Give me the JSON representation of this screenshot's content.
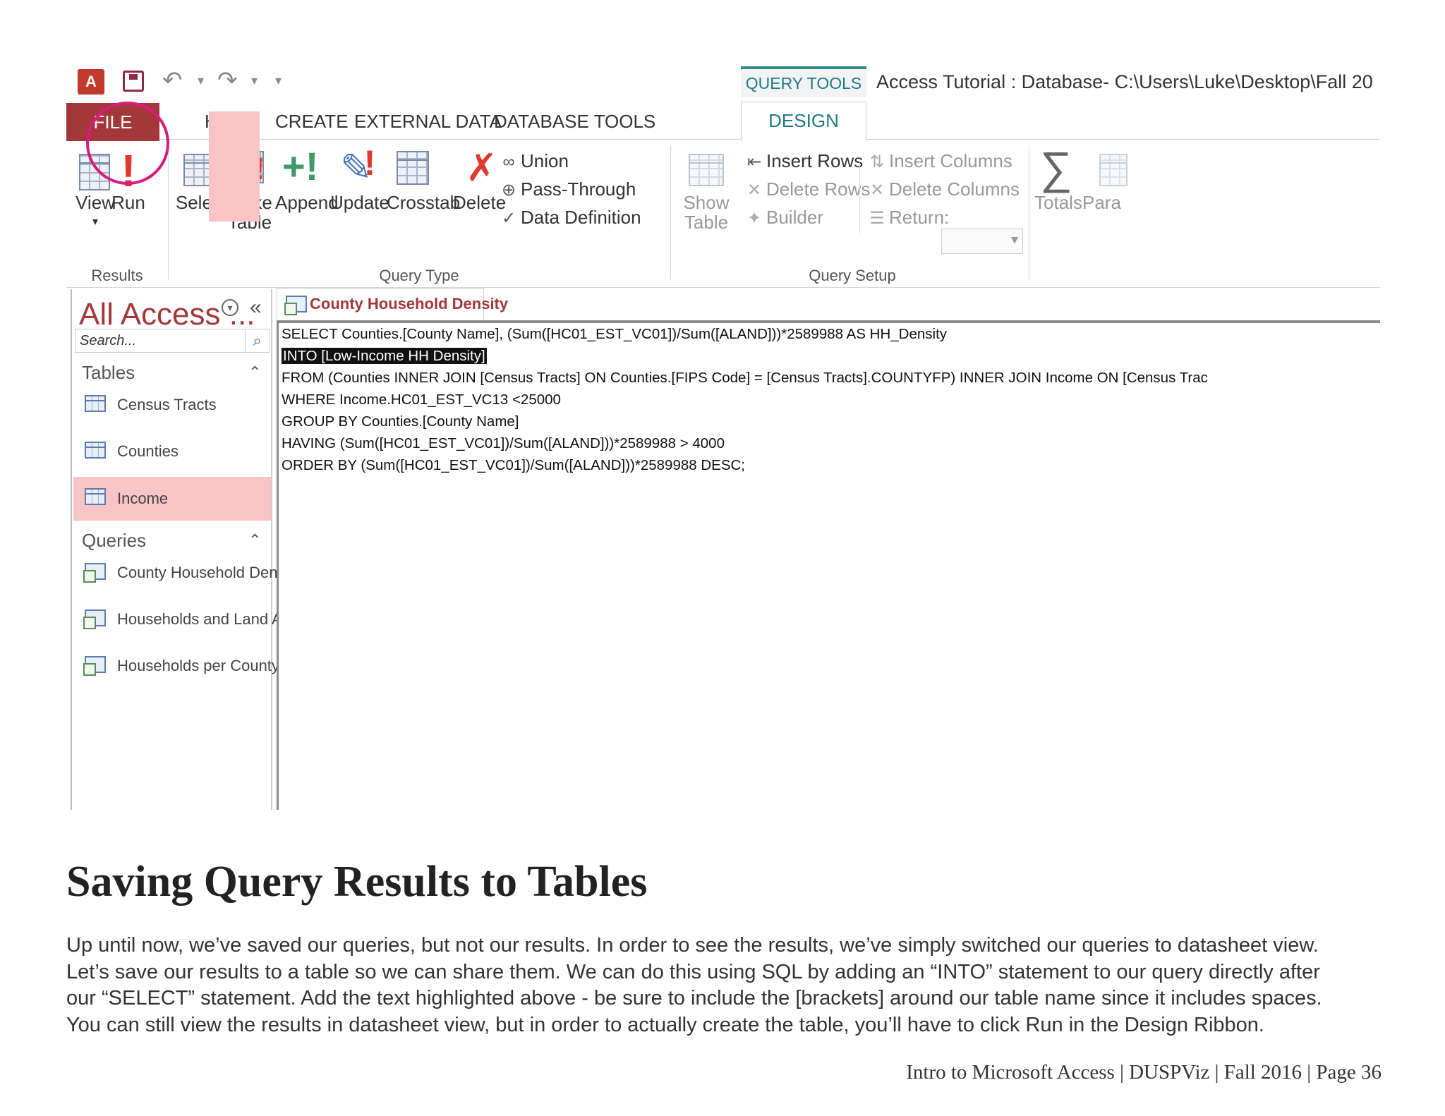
{
  "app": {
    "quick_access": {
      "app_icon": "A",
      "undo_icon": "↶",
      "redo_icon": "↷",
      "more_icon": "▾"
    },
    "context_tab": "QUERY TOOLS",
    "window_title": "Access Tutorial : Database- C:\\Users\\Luke\\Desktop\\Fall 20",
    "tabs": [
      "FILE",
      "HOME",
      "CREATE",
      "EXTERNAL DATA",
      "DATABASE TOOLS",
      "DESIGN"
    ],
    "ribbon": {
      "results": {
        "label": "Results",
        "view": "View",
        "run": "Run"
      },
      "query_type": {
        "label": "Query Type",
        "select": "Select",
        "make_table_line1": "Make",
        "make_table_line2": "Table",
        "append": "Append",
        "update": "Update",
        "crosstab": "Crosstab",
        "delete": "Delete",
        "union": "Union",
        "pass_through": "Pass-Through",
        "data_definition": "Data Definition"
      },
      "query_setup": {
        "label": "Query Setup",
        "show_table_line1": "Show",
        "show_table_line2": "Table",
        "insert_rows": "Insert Rows",
        "delete_rows": "Delete Rows",
        "builder": "Builder",
        "insert_columns": "Insert Columns",
        "delete_columns": "Delete Columns",
        "return": "Return:"
      },
      "show_hide": {
        "totals": "Totals",
        "parameters": "Para"
      }
    },
    "nav": {
      "title": "All Access ...",
      "search_placeholder": "Search...",
      "tables_header": "Tables",
      "tables": [
        "Census Tracts",
        "Counties",
        "Income"
      ],
      "selected_table": "Income",
      "queries_header": "Queries",
      "queries": [
        "County Household Dens...",
        "Households and Land A...",
        "Households per County"
      ]
    },
    "document": {
      "tab_title": "County Household Density",
      "sql": {
        "line1": "SELECT Counties.[County Name], (Sum([HC01_EST_VC01])/Sum([ALAND]))*2589988 AS HH_Density",
        "line2": "INTO [Low-Income HH Density]",
        "line3": "FROM (Counties INNER JOIN [Census Tracts] ON Counties.[FIPS Code] = [Census Tracts].COUNTYFP) INNER JOIN Income ON [Census Trac",
        "line4": "WHERE Income.HC01_EST_VC13 <25000",
        "line5": "GROUP BY Counties.[County Name]",
        "line6": "HAVING (Sum([HC01_EST_VC01])/Sum([ALAND]))*2589988 > 4000",
        "line7": "ORDER BY (Sum([HC01_EST_VC01])/Sum([ALAND]))*2589988 DESC;"
      }
    }
  },
  "heading": "Saving Query Results to Tables",
  "paragraph": [
    "Up until now, we’ve saved our queries, but not our results. In order to see the results, we’ve simply switched our queries to datasheet view.",
    "Let’s save our results to a table so we can share them. We can do this using SQL by adding an “INTO” statement to our query directly after",
    "our “SELECT” statement. Add the text highlighted above - be sure to include the [brackets] around our table name since it includes spaces.",
    "You can still view the results in datasheet view, but in order to actually create the table, you’ll have to click Run in the Design Ribbon."
  ],
  "footer": "Intro to Microsoft Access | DUSPViz | Fall 2016 | Page 36",
  "colors": {
    "file_tab": "#a4373a",
    "accent_teal": "#1e7b86",
    "highlight_pink": "#f9c4c6",
    "run_circle": "#d81b7c"
  }
}
